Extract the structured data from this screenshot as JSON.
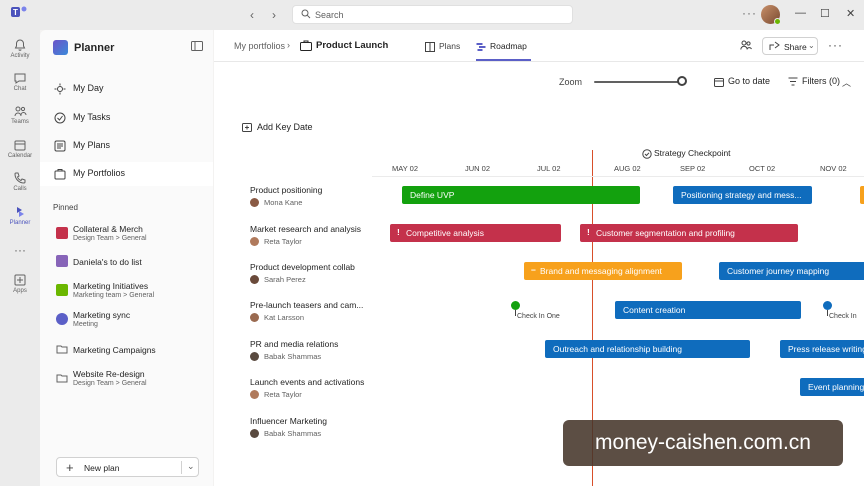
{
  "rail": {
    "items": [
      {
        "label": "Activity",
        "icon": "bell-icon"
      },
      {
        "label": "Chat",
        "icon": "chat-icon"
      },
      {
        "label": "Teams",
        "icon": "teams-icon"
      },
      {
        "label": "Calendar",
        "icon": "calendar-icon"
      },
      {
        "label": "Calls",
        "icon": "phone-icon"
      },
      {
        "label": "Planner",
        "icon": "planner-icon"
      },
      {
        "label": "Apps",
        "icon": "apps-icon"
      }
    ]
  },
  "topbar": {
    "search_placeholder": "Search"
  },
  "sidebar": {
    "title": "Planner",
    "nav": [
      {
        "label": "My Day"
      },
      {
        "label": "My Tasks"
      },
      {
        "label": "My Plans"
      },
      {
        "label": "My Portfolios"
      }
    ],
    "pinned_label": "Pinned",
    "plans": [
      {
        "title": "Collateral & Merch",
        "sub": "Design Team > General",
        "color": "#c4314b"
      },
      {
        "title": "Daniela's to do list",
        "sub": "",
        "color": "#8764b8"
      },
      {
        "title": "Marketing Initiatives",
        "sub": "Marketing team > General",
        "color": "#6bb700"
      },
      {
        "title": "Marketing sync",
        "sub": "Meeting",
        "color": "#5b5fc7"
      },
      {
        "title": "Marketing Campaigns",
        "sub": "",
        "color": "#616161"
      },
      {
        "title": "Website Re-design",
        "sub": "Design Team > General",
        "color": "#616161"
      }
    ],
    "new_plan_label": "New plan"
  },
  "header": {
    "breadcrumb": "My portfolios",
    "project": "Product Launch",
    "tabs": [
      {
        "label": "Plans"
      },
      {
        "label": "Roadmap"
      }
    ],
    "share_label": "Share"
  },
  "toolbar": {
    "zoom_label": "Zoom",
    "goto_label": "Go to date",
    "filters_label": "Filters (0)",
    "add_key_date": "Add Key Date"
  },
  "timeline": {
    "milestone": "Strategy Checkpoint",
    "months": [
      "MAY 02",
      "JUN 02",
      "JUL 02",
      "AUG 02",
      "SEP 02",
      "OCT 02",
      "NOV 02"
    ]
  },
  "rows": [
    {
      "title": "Product positioning",
      "owner": "Mona Kane",
      "avatar": "#8a5a44"
    },
    {
      "title": "Market research and analysis",
      "owner": "Reta Taylor",
      "avatar": "#b07a5c"
    },
    {
      "title": "Product development collab",
      "owner": "Sarah Perez",
      "avatar": "#6a4a3a"
    },
    {
      "title": "Pre-launch teasers and cam...",
      "owner": "Kat Larsson",
      "avatar": "#9a6a50"
    },
    {
      "title": "PR and media relations",
      "owner": "Babak Shammas",
      "avatar": "#5a4a40"
    },
    {
      "title": "Launch events and activations",
      "owner": "Reta Taylor",
      "avatar": "#b07a5c"
    },
    {
      "title": "Influencer Marketing",
      "owner": "Babak Shammas",
      "avatar": "#5a4a40"
    }
  ],
  "bars": {
    "b0": "Define UVP",
    "b1": "Positioning strategy and mess...",
    "b2": "Competitive analysis",
    "b3": "Customer segmentation and profiling",
    "b4": "Brand and messaging alignment",
    "b5": "Customer journey mapping",
    "b6": "Content creation",
    "b7": "Outreach and relationship building",
    "b8": "Press release writing",
    "b9": "Event planning"
  },
  "checkins": {
    "c0": "Check In One",
    "c1": "Check In"
  },
  "colors": {
    "accent": "#5b5fc7",
    "blue_bar": "#0f6cbd",
    "red_bar": "#c4314b",
    "green_bar": "#13a10e",
    "orange_bar": "#f7a11c",
    "today": "#d84f2a"
  },
  "watermark": "money-caishen.com.cn"
}
